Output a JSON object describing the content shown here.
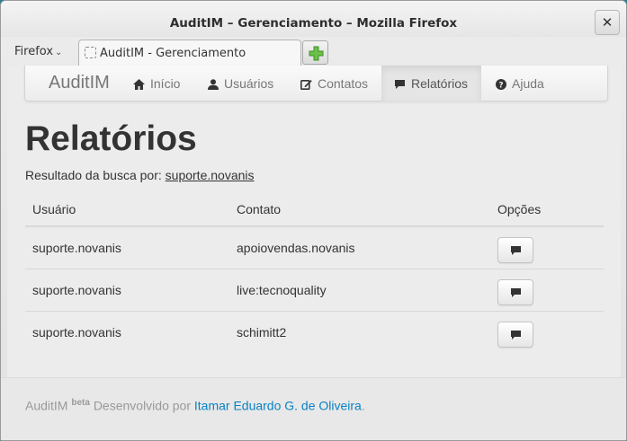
{
  "window": {
    "title": "AuditIM – Gerenciamento – Mozilla Firefox",
    "close_label": "✕"
  },
  "tabbar": {
    "menu_label": "Firefox",
    "tab_title": "AuditIM - Gerenciamento"
  },
  "navbar": {
    "brand": "AuditIM",
    "items": [
      {
        "label": "Início",
        "icon": "home-icon"
      },
      {
        "label": "Usuários",
        "icon": "user-icon"
      },
      {
        "label": "Contatos",
        "icon": "edit-icon"
      },
      {
        "label": "Relatórios",
        "icon": "comment-icon",
        "active": true
      },
      {
        "label": "Ajuda",
        "icon": "question-icon"
      }
    ]
  },
  "page": {
    "title": "Relatórios",
    "search_prefix": "Resultado da busca por:",
    "search_term": "suporte.novanis"
  },
  "table": {
    "headers": [
      "Usuário",
      "Contato",
      "Opções"
    ],
    "rows": [
      {
        "usuario": "suporte.novanis",
        "contato": "apoiovendas.novanis"
      },
      {
        "usuario": "suporte.novanis",
        "contato": "live:tecnoquality"
      },
      {
        "usuario": "suporte.novanis",
        "contato": "schimitt2"
      }
    ]
  },
  "footer": {
    "app_name": "AuditIM",
    "beta": "beta",
    "developed_by": "Desenvolvido por",
    "author": "Itamar Eduardo G. de Oliveira",
    "period": "."
  },
  "colors": {
    "link": "#0a82c4",
    "newtab_plus": "#6cc04a"
  }
}
